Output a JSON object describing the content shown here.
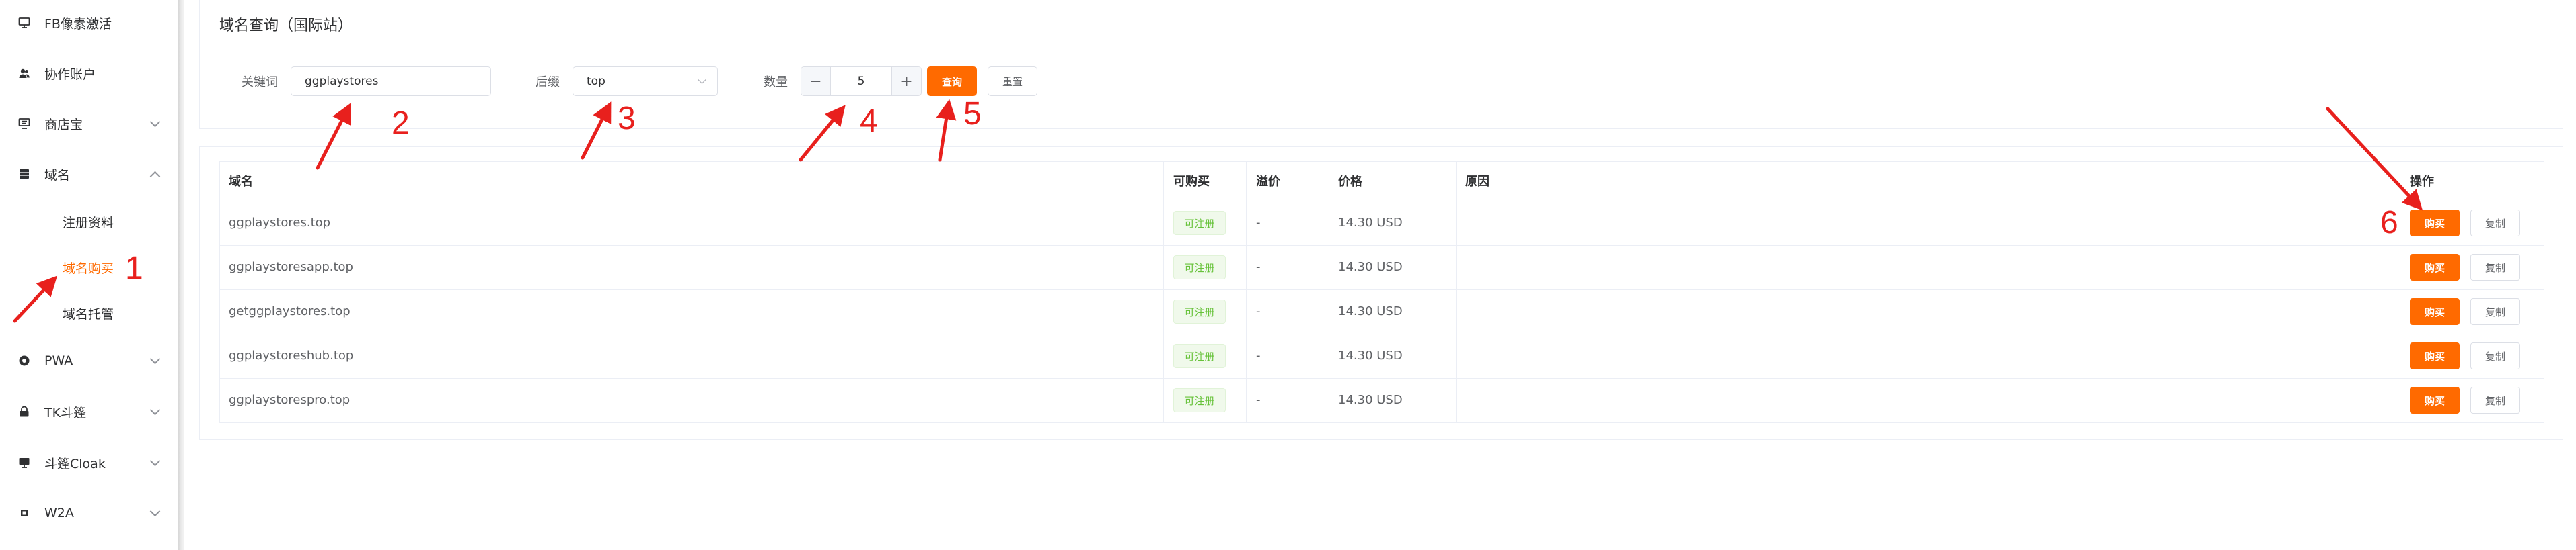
{
  "sidebar": {
    "items": [
      {
        "label": "FB像素激活",
        "icon": "monitor-icon"
      },
      {
        "label": "协作账户",
        "icon": "users-icon"
      },
      {
        "label": "商店宝",
        "icon": "monitor-icon"
      },
      {
        "label": "域名",
        "icon": "server-icon"
      },
      {
        "label": "PWA",
        "icon": "gear-circle-icon"
      },
      {
        "label": "TK斗篷",
        "icon": "lock-icon"
      },
      {
        "label": "斗篷Cloak",
        "icon": "monitor-icon"
      },
      {
        "label": "W2A",
        "icon": "grid-icon"
      }
    ],
    "sub_items": [
      {
        "label": "注册资料",
        "active": false
      },
      {
        "label": "域名购买",
        "active": true
      },
      {
        "label": "域名托管",
        "active": false
      }
    ]
  },
  "main": {
    "title": "域名查询（国际站）",
    "search": {
      "keyword_label": "关键词",
      "keyword_value": "ggplaystores",
      "suffix_label": "后缀",
      "suffix_value": "top",
      "quantity_label": "数量",
      "quantity_value": "5",
      "minus_symbol": "−",
      "plus_symbol": "+",
      "query_button": "查询",
      "reset_button": "重置"
    },
    "table": {
      "headers": [
        "域名",
        "可购买",
        "溢价",
        "价格",
        "原因",
        "操作"
      ],
      "rows": [
        {
          "domain": "ggplaystores.top",
          "status": "可注册",
          "premium": "-",
          "price": "14.30 USD",
          "buy": "购买",
          "copy": "复制"
        },
        {
          "domain": "ggplaystoresapp.top",
          "status": "可注册",
          "premium": "-",
          "price": "14.30 USD",
          "buy": "购买",
          "copy": "复制"
        },
        {
          "domain": "getggplaystores.top",
          "status": "可注册",
          "premium": "-",
          "price": "14.30 USD",
          "buy": "购买",
          "copy": "复制"
        },
        {
          "domain": "ggplaystoreshub.top",
          "status": "可注册",
          "premium": "-",
          "price": "14.30 USD",
          "buy": "购买",
          "copy": "复制"
        },
        {
          "domain": "ggplaystorespro.top",
          "status": "可注册",
          "premium": "-",
          "price": "14.30 USD",
          "buy": "购买",
          "copy": "复制"
        }
      ]
    }
  },
  "annotations": [
    "1",
    "2",
    "3",
    "4",
    "5",
    "6"
  ],
  "colors": {
    "accent": "#ff6a00",
    "annotation": "#e8201d",
    "success_text": "#67c23a",
    "success_bg": "#f0f9eb"
  }
}
